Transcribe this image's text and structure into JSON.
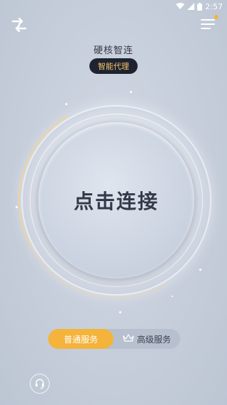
{
  "status_bar": {
    "time": "2:57",
    "icons": [
      "wifi-icon",
      "signal-icon",
      "battery-icon"
    ]
  },
  "header": {
    "left_icon": "mode-switch-arrows-icon",
    "right_icon": "menu-icon",
    "menu_notification": true
  },
  "app": {
    "title": "硬核智连",
    "badge": "智能代理"
  },
  "connect": {
    "label": "点击连接"
  },
  "modes": {
    "items": [
      {
        "label": "普通服务",
        "active": true
      },
      {
        "label": "高级服务",
        "active": false,
        "icon": "crown-icon"
      }
    ]
  },
  "footer": {
    "support_icon": "customer-service-icon"
  },
  "colors": {
    "accent": "#f4b33a",
    "badge_bg": "#1f2330",
    "badge_text": "#f5c36a",
    "background": "#c6cedb",
    "text_dark": "#343a48"
  }
}
